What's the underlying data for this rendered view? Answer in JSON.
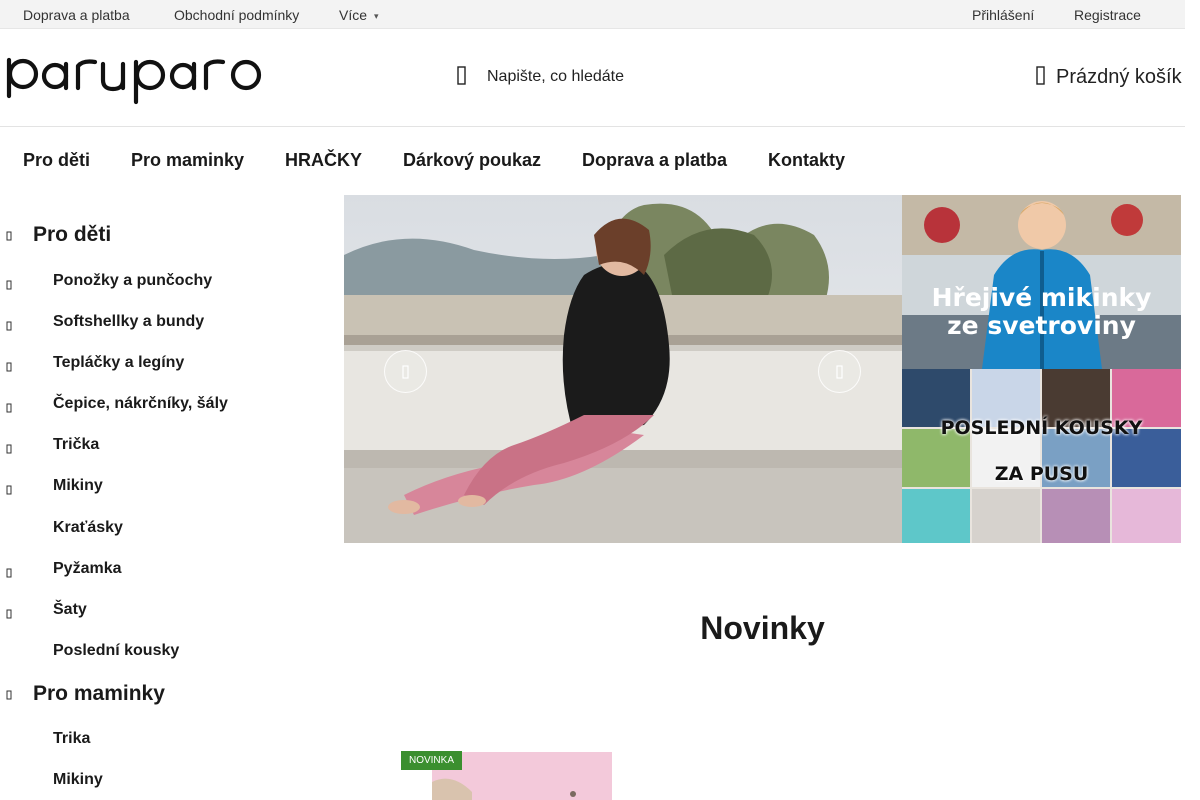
{
  "topbar": {
    "links": [
      "Doprava a platba",
      "Obchodní podmínky"
    ],
    "more_label": "Více",
    "login_label": "Přihlášení",
    "register_label": "Registrace"
  },
  "header": {
    "logo_text": "paruparo",
    "search_placeholder": "Napište, co hledáte",
    "cart_label": "Prázdný košík"
  },
  "main_nav": [
    "Pro děti",
    "Pro maminky",
    "HRAČKY",
    "Dárkový poukaz",
    "Doprava a platba",
    "Kontakty"
  ],
  "sidebar": {
    "categories": [
      {
        "label": "Pro děti",
        "level": "top",
        "expandable": true
      },
      {
        "label": "Ponožky a punčochy",
        "level": "sub",
        "expandable": true
      },
      {
        "label": "Softshellky a bundy",
        "level": "sub",
        "expandable": true
      },
      {
        "label": "Tepláčky a legíny",
        "level": "sub",
        "expandable": true
      },
      {
        "label": "Čepice, nákrčníky, šály",
        "level": "sub",
        "expandable": true
      },
      {
        "label": "Trička",
        "level": "sub",
        "expandable": true
      },
      {
        "label": "Mikiny",
        "level": "sub",
        "expandable": true
      },
      {
        "label": "Kraťásky",
        "level": "sub",
        "expandable": false
      },
      {
        "label": "Pyžamka",
        "level": "sub",
        "expandable": true
      },
      {
        "label": "Šaty",
        "level": "sub",
        "expandable": true
      },
      {
        "label": "Poslední kousky",
        "level": "sub",
        "expandable": false
      },
      {
        "label": "Pro maminky",
        "level": "top",
        "expandable": true
      },
      {
        "label": "Trika",
        "level": "sub",
        "expandable": false
      },
      {
        "label": "Mikiny",
        "level": "sub",
        "expandable": false
      }
    ]
  },
  "banners": {
    "promo1_line1": "Hřejivé mikinky",
    "promo1_line2": "ze svetroviny",
    "promo2_line1": "POSLEDNÍ KOUSKY",
    "promo2_line2": "ZA PUSU"
  },
  "section": {
    "title": "Novinky",
    "badge": "NOVINKA"
  },
  "colors": {
    "badge_green": "#3b8f2f",
    "topbar_bg": "#f3f3f3",
    "text": "#1a1a1a"
  }
}
